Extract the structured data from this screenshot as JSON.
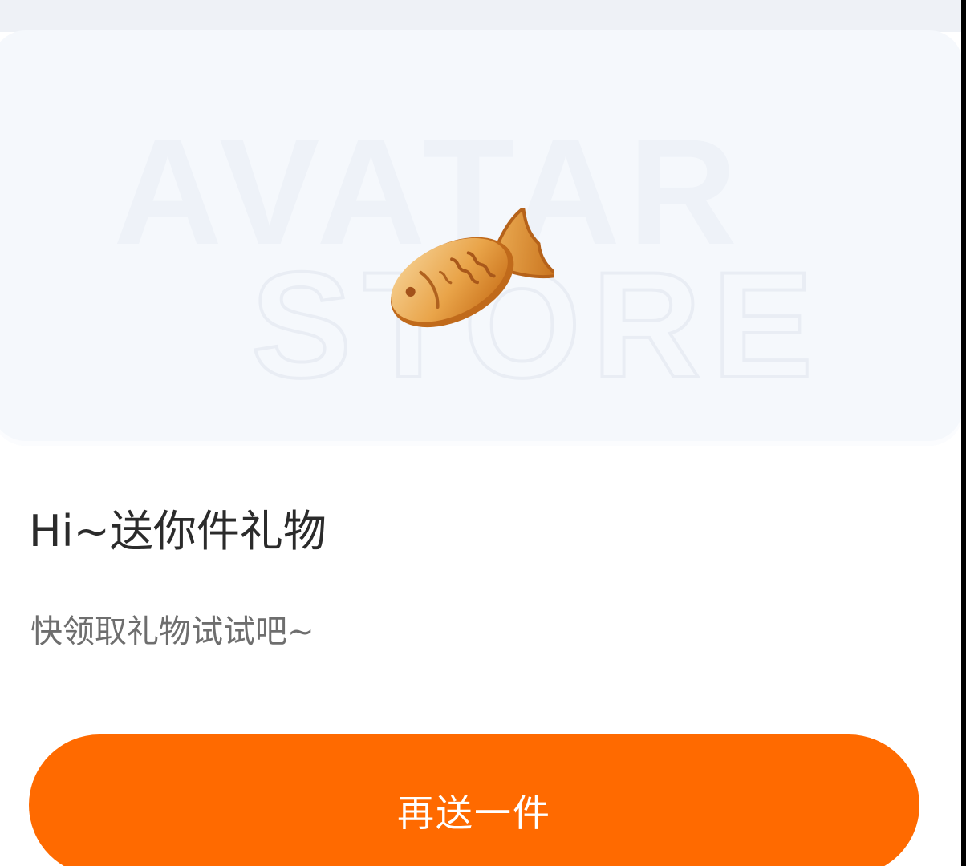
{
  "gift_card": {
    "watermark_line1": "AVATAR",
    "watermark_line2": "STORE",
    "gift_icon": "taiyaki-fish-icon"
  },
  "greeting": "Hi~送你件礼物",
  "subtitle": "快领取礼物试试吧~",
  "send_button": {
    "label": "再送一件"
  },
  "colors": {
    "accent": "#ff6a00",
    "card_bg": "#f5f8fc",
    "title_text": "#2b2b2b",
    "subtitle_text": "#6e6e6e"
  }
}
